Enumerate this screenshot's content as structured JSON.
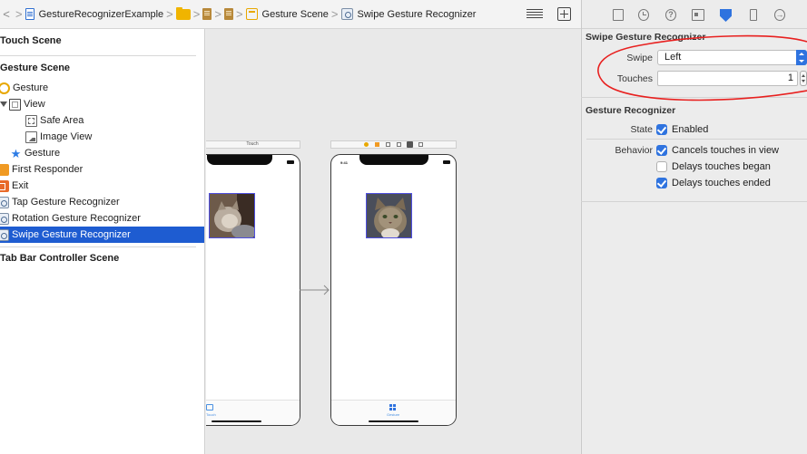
{
  "jumpbar": {
    "crumbs": [
      "GestureRecognizerExample",
      "Gesture Scene",
      "Swipe Gesture Recognizer"
    ],
    "back_glyph": "<",
    "separator": ">"
  },
  "outline": {
    "items": [
      {
        "label": "Touch Scene",
        "kind": "section"
      },
      {
        "label": "Gesture Scene",
        "kind": "section"
      },
      {
        "label": "Gesture",
        "icon": "view-controller-icon"
      },
      {
        "label": "View",
        "icon": "view-icon"
      },
      {
        "label": "Safe Area",
        "icon": "safe-area-icon"
      },
      {
        "label": "Image View",
        "icon": "image-view-icon"
      },
      {
        "label": "Gesture",
        "icon": "tab-bar-item-star-icon"
      },
      {
        "label": "First Responder",
        "icon": "first-responder-icon"
      },
      {
        "label": "Exit",
        "icon": "exit-icon"
      },
      {
        "label": "Tap Gesture Recognizer",
        "icon": "gesture-recognizer-icon"
      },
      {
        "label": "Rotation Gesture Recognizer",
        "icon": "gesture-recognizer-icon"
      },
      {
        "label": "Swipe Gesture Recognizer",
        "icon": "gesture-recognizer-icon",
        "selected": true
      },
      {
        "label": "Tab Bar Controller Scene",
        "kind": "section"
      }
    ]
  },
  "canvas": {
    "left_scene_title": "Touch",
    "status_time": "9:41"
  },
  "inspector": {
    "swipe_section": "Swipe Gesture Recognizer",
    "swipe_label": "Swipe",
    "swipe_value": "Left",
    "touches_label": "Touches",
    "touches_value": "1",
    "gesture_section": "Gesture Recognizer",
    "state_label": "State",
    "enabled_label": "Enabled",
    "enabled_checked": true,
    "behavior_label": "Behavior",
    "cancels_label": "Cancels touches in view",
    "cancels_checked": true,
    "delays_began_label": "Delays touches began",
    "delays_began_checked": false,
    "delays_ended_label": "Delays touches ended",
    "delays_ended_checked": true
  },
  "colors": {
    "selection": "#1e5cd1",
    "accent": "#2f73df",
    "annotation_ellipse": "#e8201f"
  }
}
